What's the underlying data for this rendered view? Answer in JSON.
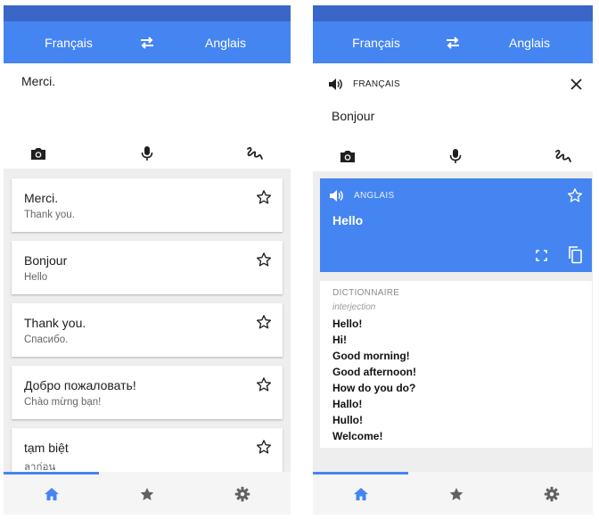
{
  "colors": {
    "appbar": "#4585f1",
    "statusbar": "#3a66c8",
    "accent": "#4585f1",
    "icon": "#202020",
    "nav_icon": "#616161"
  },
  "left": {
    "header": {
      "source_lang": "Français",
      "swap_icon": "swap-arrows-icon",
      "target_lang": "Anglais"
    },
    "input": {
      "text": "Merci."
    },
    "tools": [
      "camera-icon",
      "microphone-icon",
      "handwriting-icon"
    ],
    "history": [
      {
        "source": "Merci.",
        "translation": "Thank you."
      },
      {
        "source": "Bonjour",
        "translation": "Hello"
      },
      {
        "source": "Thank you.",
        "translation": "Спасибо."
      },
      {
        "source": "Добро пожаловать!",
        "translation": "Chào mừng bạn!"
      },
      {
        "source": "tạm biệt",
        "translation": "ลาก่อน"
      }
    ],
    "nav": {
      "active": "home",
      "items": [
        "home-icon",
        "star-icon",
        "settings-icon"
      ]
    }
  },
  "right": {
    "header": {
      "source_lang": "Français",
      "swap_icon": "swap-arrows-icon",
      "target_lang": "Anglais"
    },
    "input": {
      "lang_label": "FRANÇAIS",
      "text": "Bonjour"
    },
    "result": {
      "lang_label": "ANGLAIS",
      "text": "Hello"
    },
    "dictionary": {
      "heading": "DICTIONNAIRE",
      "part_of_speech": "interjection",
      "entries": [
        "Hello!",
        "Hi!",
        "Good morning!",
        "Good afternoon!",
        "How do you do?",
        "Hallo!",
        "Hullo!",
        "Welcome!"
      ]
    },
    "nav": {
      "active": "home",
      "items": [
        "home-icon",
        "star-icon",
        "settings-icon"
      ]
    }
  }
}
